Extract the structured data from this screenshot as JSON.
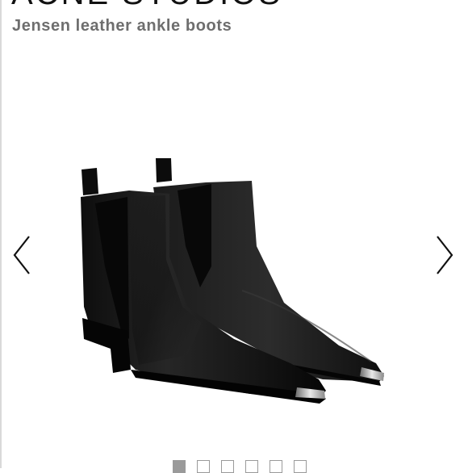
{
  "header": {
    "brand": "ACNE STUDIOS",
    "product_name": "Jensen leather ankle boots"
  },
  "gallery": {
    "image": "black pointed-toe leather chelsea ankle boots with metal toe caps",
    "prev_icon": "chevron-left-icon",
    "next_icon": "chevron-right-icon",
    "slide_count": 6,
    "active_slide": 1
  },
  "colors": {
    "text": "#111111",
    "subtitle": "#6e6e6e",
    "leather": "#0b0b0b"
  }
}
